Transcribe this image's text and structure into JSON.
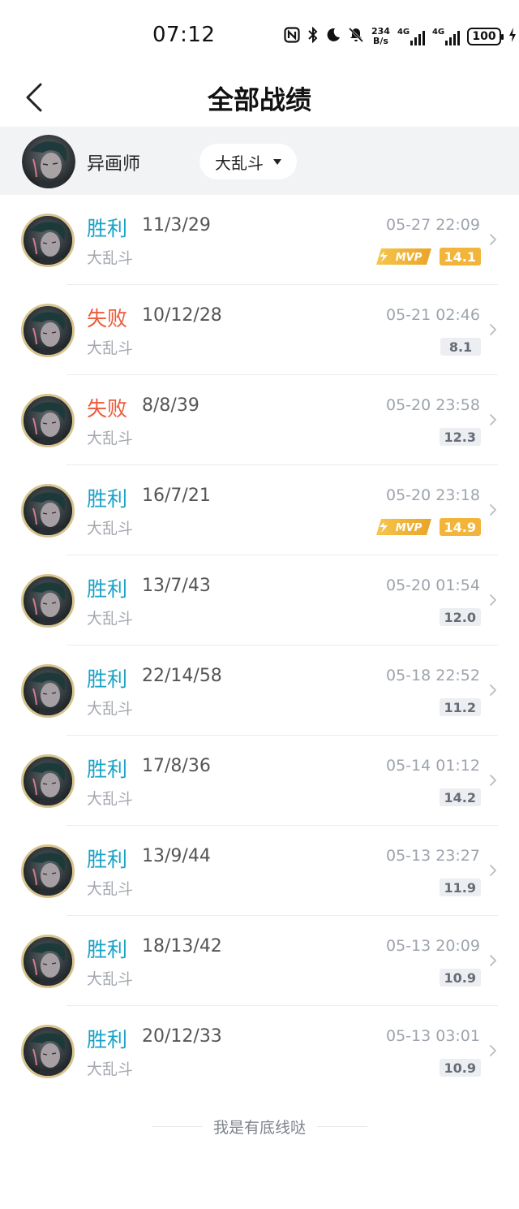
{
  "status_bar": {
    "time": "07:12",
    "net_speed_value": "234",
    "net_speed_unit": "B/s",
    "sim1_label": "4G",
    "sim2_label": "4G",
    "battery": "100",
    "icons": [
      "nfc-icon",
      "bluetooth-icon",
      "moon-icon",
      "bell-muted-icon",
      "signal-icon",
      "battery-icon",
      "charging-icon"
    ]
  },
  "header": {
    "title": "全部战绩"
  },
  "profile": {
    "name": "异画师",
    "mode_filter": "大乱斗"
  },
  "matches": [
    {
      "result": "胜利",
      "outcome": "win",
      "kda": "11/3/29",
      "mode": "大乱斗",
      "time": "05-27 22:09",
      "score": "14.1",
      "mvp": true
    },
    {
      "result": "失败",
      "outcome": "loss",
      "kda": "10/12/28",
      "mode": "大乱斗",
      "time": "05-21 02:46",
      "score": "8.1",
      "mvp": false
    },
    {
      "result": "失败",
      "outcome": "loss",
      "kda": "8/8/39",
      "mode": "大乱斗",
      "time": "05-20 23:58",
      "score": "12.3",
      "mvp": false
    },
    {
      "result": "胜利",
      "outcome": "win",
      "kda": "16/7/21",
      "mode": "大乱斗",
      "time": "05-20 23:18",
      "score": "14.9",
      "mvp": true
    },
    {
      "result": "胜利",
      "outcome": "win",
      "kda": "13/7/43",
      "mode": "大乱斗",
      "time": "05-20 01:54",
      "score": "12.0",
      "mvp": false
    },
    {
      "result": "胜利",
      "outcome": "win",
      "kda": "22/14/58",
      "mode": "大乱斗",
      "time": "05-18 22:52",
      "score": "11.2",
      "mvp": false
    },
    {
      "result": "胜利",
      "outcome": "win",
      "kda": "17/8/36",
      "mode": "大乱斗",
      "time": "05-14 01:12",
      "score": "14.2",
      "mvp": false
    },
    {
      "result": "胜利",
      "outcome": "win",
      "kda": "13/9/44",
      "mode": "大乱斗",
      "time": "05-13 23:27",
      "score": "11.9",
      "mvp": false
    },
    {
      "result": "胜利",
      "outcome": "win",
      "kda": "18/13/42",
      "mode": "大乱斗",
      "time": "05-13 20:09",
      "score": "10.9",
      "mvp": false
    },
    {
      "result": "胜利",
      "outcome": "win",
      "kda": "20/12/33",
      "mode": "大乱斗",
      "time": "05-13 03:01",
      "score": "10.9",
      "mvp": false
    }
  ],
  "mvp_label": "MVP",
  "footer": "我是有底线哒",
  "colors": {
    "win": "#1aa2c6",
    "loss": "#ee5a3a",
    "mvp_gold": "#f2b43a",
    "avatar_ring": "#d8c48e"
  }
}
